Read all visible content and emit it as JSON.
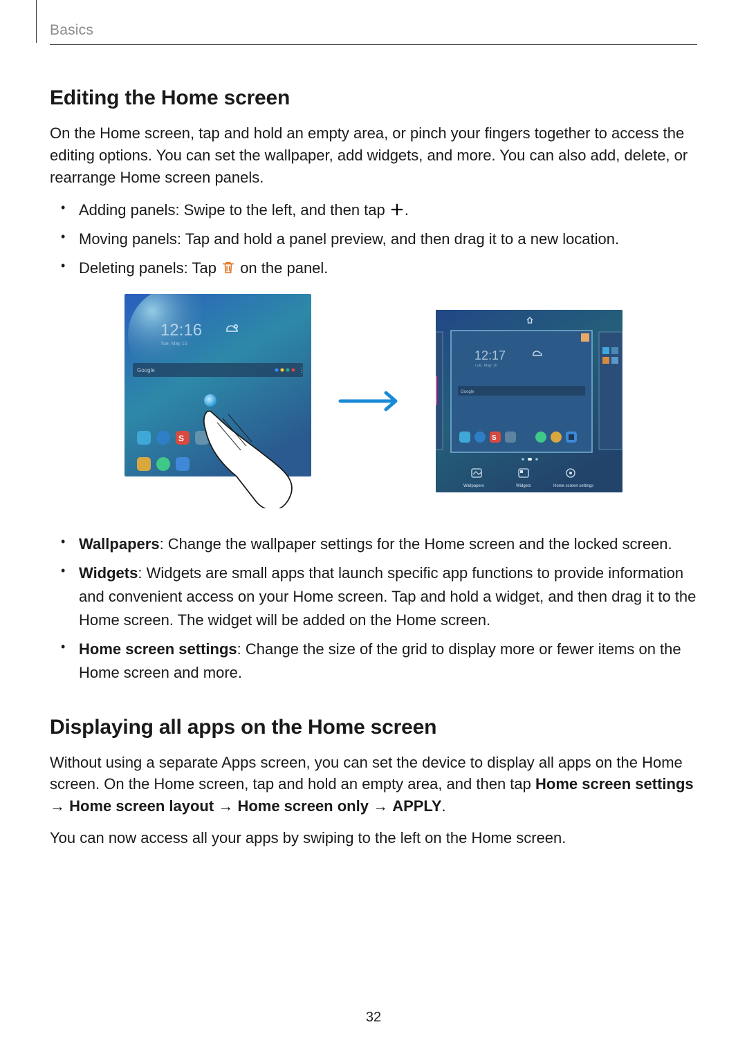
{
  "header": {
    "section": "Basics"
  },
  "section1": {
    "title": "Editing the Home screen",
    "intro": "On the Home screen, tap and hold an empty area, or pinch your fingers together to access the editing options. You can set the wallpaper, add widgets, and more. You can also add, delete, or rearrange Home screen panels.",
    "bullets_a": [
      {
        "prefix": "Adding panels: Swipe to the left, and then tap ",
        "icon": "plus-icon",
        "suffix": "."
      },
      {
        "text": "Moving panels: Tap and hold a panel preview, and then drag it to a new location."
      },
      {
        "prefix": "Deleting panels: Tap ",
        "icon": "trash-icon",
        "suffix": " on the panel."
      }
    ],
    "bullets_b": [
      {
        "label": "Wallpapers",
        "text": ": Change the wallpaper settings for the Home screen and the locked screen."
      },
      {
        "label": "Widgets",
        "text": ": Widgets are small apps that launch specific app functions to provide information and convenient access on your Home screen. Tap and hold a widget, and then drag it to the Home screen. The widget will be added on the Home screen."
      },
      {
        "label": "Home screen settings",
        "text": ": Change the size of the grid to display more or fewer items on the Home screen and more."
      }
    ]
  },
  "section2": {
    "title": "Displaying all apps on the Home screen",
    "para1_pre": "Without using a separate Apps screen, you can set the device to display all apps on the Home screen. On the Home screen, tap and hold an empty area, and then tap ",
    "path_parts": [
      "Home screen settings",
      "Home screen layout",
      "Home screen only",
      "APPLY"
    ],
    "para1_post": ".",
    "para2": "You can now access all your apps by swiping to the left on the Home screen."
  },
  "illustration": {
    "left_time": "12:16",
    "right_time": "12:17"
  },
  "icons": {
    "plus_color": "#000000",
    "trash_color": "#e07a2a",
    "arrow_color": "#1a8ad6"
  },
  "page_number": "32"
}
